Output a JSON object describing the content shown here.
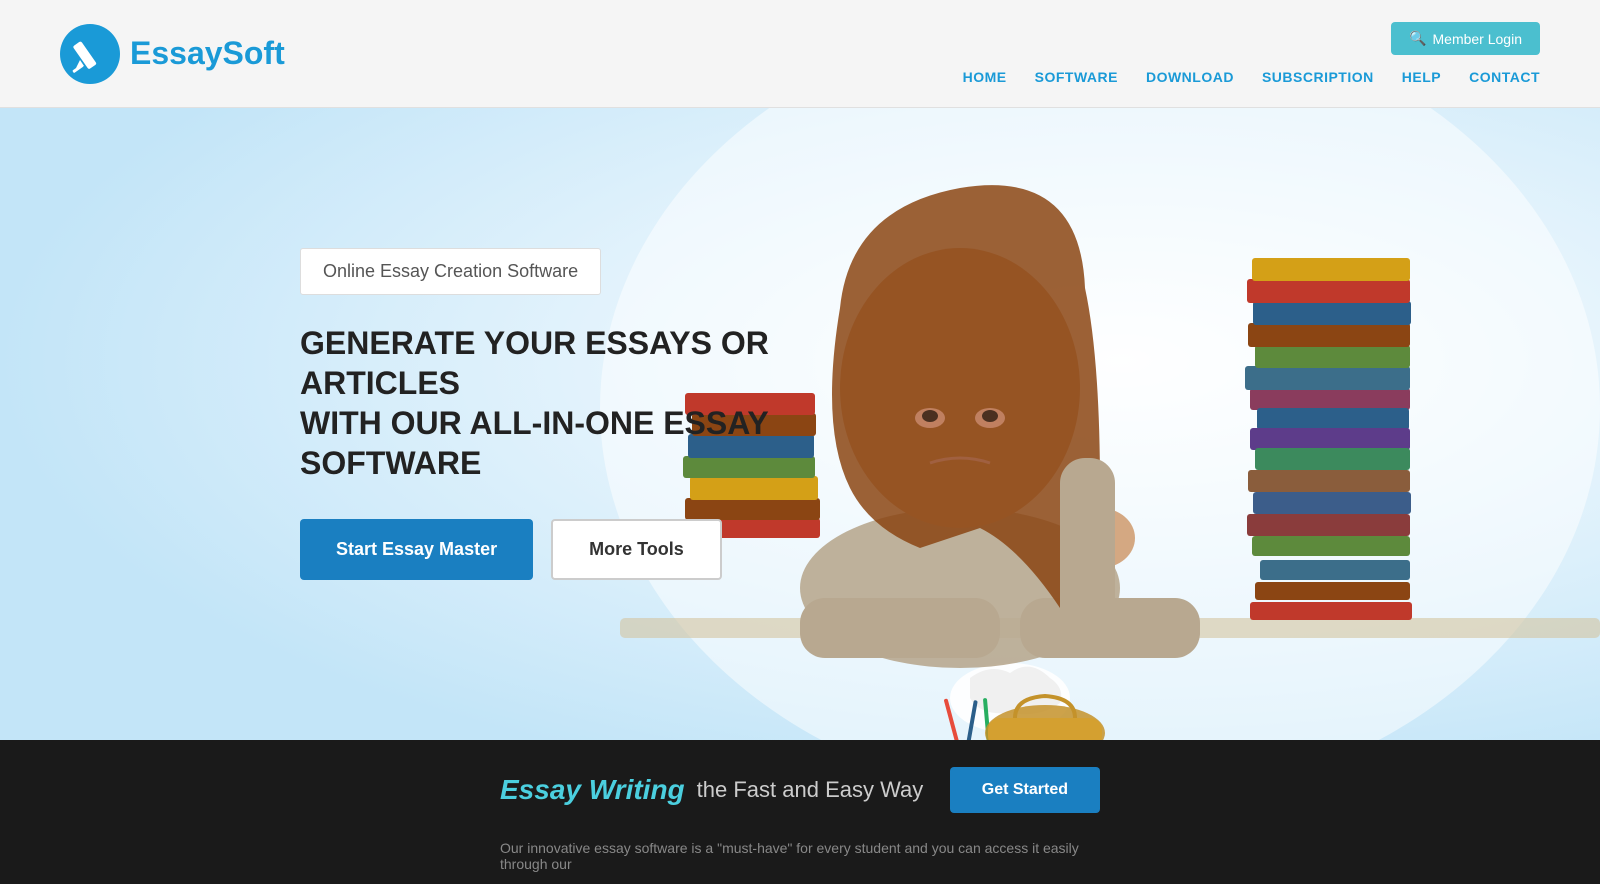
{
  "header": {
    "logo_text_regular": "Essay",
    "logo_text_bold": "Soft",
    "member_login_label": "Member Login",
    "nav_items": [
      {
        "label": "HOME",
        "id": "home"
      },
      {
        "label": "SOFTWARE",
        "id": "software"
      },
      {
        "label": "DOWNLOAD",
        "id": "download"
      },
      {
        "label": "SUBSCRIPTION",
        "id": "subscription"
      },
      {
        "label": "HELP",
        "id": "help"
      },
      {
        "label": "CONTACT",
        "id": "contact"
      }
    ]
  },
  "hero": {
    "subtitle": "Online Essay Creation Software",
    "heading_line1": "GENERATE YOUR ESSAYS OR ARTICLES",
    "heading_line2": "WITH OUR ALL-IN-ONE ESSAY SOFTWARE",
    "btn_primary": "Start Essay Master",
    "btn_secondary": "More Tools"
  },
  "footer_band": {
    "writing_text": "Essay Writing",
    "tagline": "the Fast and Easy Way",
    "sub_text": "Our innovative essay software is a \"must-have\" for every student and you can access it easily through our",
    "cta_button": "Get Started"
  },
  "colors": {
    "primary_blue": "#1a7fc1",
    "accent_teal": "#4bbfcf",
    "nav_blue": "#1a9ad7",
    "dark_bg": "#1a1a1a"
  },
  "icons": {
    "member_login_icon": "🔍",
    "logo_pencil": "✏"
  }
}
